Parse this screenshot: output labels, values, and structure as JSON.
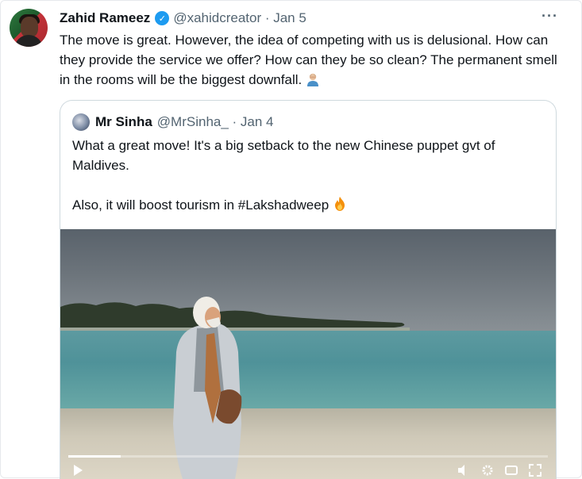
{
  "tweet": {
    "author_name": "Zahid Rameez",
    "handle_date": "@xahidcreator · Jan 5",
    "more_icon": "···",
    "text": "The move is great. However, the idea of competing with us is delusional. How can they provide the service we offer? How can they be so clean? The permanent smell in the rooms will be the biggest downfall.",
    "emoji": "person-facepalming-emoji"
  },
  "quoted": {
    "author_name": "Mr Sinha",
    "handle_date": "@MrSinha_ · Jan 4",
    "paragraph1": "What a great move! It's a big setback to the new Chinese puppet gvt of Maldives.",
    "paragraph2": "Also, it will boost tourism in #Lakshadweep",
    "emoji": "fire-emoji",
    "video": {
      "progress": 0.11
    }
  },
  "colors": {
    "verified": "#1d9bf0",
    "text": "#0f1419",
    "secondary": "#536471",
    "border": "#cfd9de"
  }
}
